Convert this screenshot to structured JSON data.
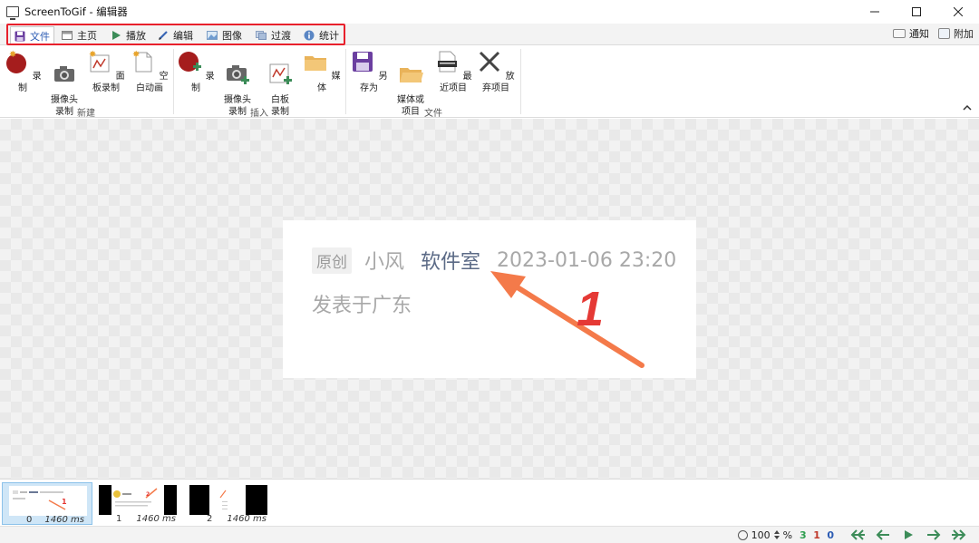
{
  "window": {
    "title": "ScreenToGif - 编辑器"
  },
  "tabs": [
    {
      "label": "文件",
      "icon": "floppy-icon",
      "active": true
    },
    {
      "label": "主页",
      "icon": "home-icon"
    },
    {
      "label": "播放",
      "icon": "play-icon"
    },
    {
      "label": "编辑",
      "icon": "pencil-icon"
    },
    {
      "label": "图像",
      "icon": "image-icon"
    },
    {
      "label": "过渡",
      "icon": "transition-icon"
    },
    {
      "label": "统计",
      "icon": "info-icon"
    }
  ],
  "right_tools": {
    "notify": "通知",
    "attach": "附加"
  },
  "ribbon": {
    "groups": [
      {
        "label": "新建",
        "buttons": [
          "录制",
          "摄像头\n录制",
          "面板录制",
          "空白动画"
        ]
      },
      {
        "label": "插入",
        "buttons": [
          "录制",
          "摄像头\n录制",
          "白板\n录制",
          "媒体"
        ]
      },
      {
        "label": "文件",
        "buttons": [
          "另存为",
          "媒体或\n项目",
          "最近项目",
          "放弃项目"
        ]
      }
    ]
  },
  "frame": {
    "badge": "原创",
    "author": "小风",
    "studio": "软件室",
    "datetime": "2023-01-06 23:20",
    "location": "发表于广东",
    "annotation_number": "1"
  },
  "colors": {
    "accent": "#2b5bb3",
    "highlight": "#e8202c",
    "arrow": "#f47a4a",
    "annotation_red": "#e53935"
  },
  "filmstrip": [
    {
      "index": "0",
      "duration": "1460 ms",
      "selected": true
    },
    {
      "index": "1",
      "duration": "1460 ms",
      "selected": false
    },
    {
      "index": "2",
      "duration": "1460 ms",
      "selected": false
    }
  ],
  "status": {
    "zoom": "100",
    "zoom_unit": "%",
    "count_total": "3",
    "count_selected": "1",
    "count_current": "0"
  }
}
